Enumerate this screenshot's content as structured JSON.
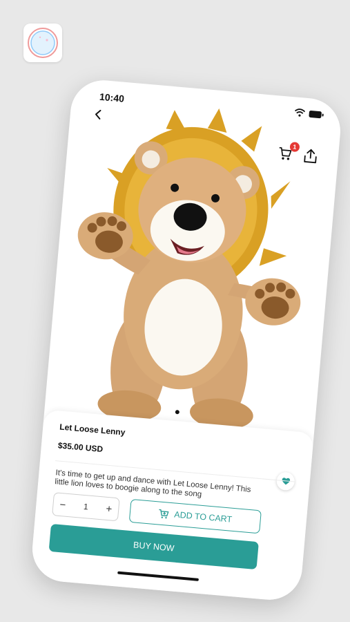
{
  "status_bar": {
    "time": "10:40"
  },
  "header": {
    "cart_count": "1"
  },
  "product": {
    "title": "Let Loose Lenny",
    "price": "$35.00 USD",
    "description": "It's time to get up and dance with Let Loose Lenny! This little lion loves to boogie along to the song"
  },
  "quantity": {
    "minus_label": "−",
    "value": "1",
    "plus_label": "+"
  },
  "actions": {
    "add_to_cart_label": "ADD TO CART",
    "buy_now_label": "BUY NOW"
  },
  "colors": {
    "accent": "#2a9d96",
    "badge": "#e53935",
    "background": "#e8e8e8"
  },
  "icons": [
    "back-icon",
    "wifi-icon",
    "battery-icon",
    "cart-icon",
    "share-icon",
    "heart-icon"
  ]
}
